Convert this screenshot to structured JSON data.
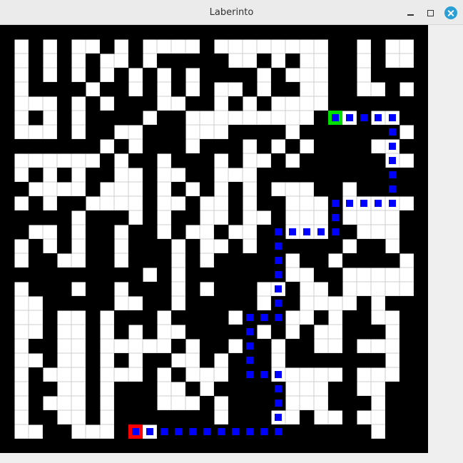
{
  "window": {
    "title": "Laberinto",
    "controls": [
      "minimize-icon",
      "maximize-icon",
      "close-icon"
    ]
  },
  "maze": {
    "columns": 30,
    "rows": 30,
    "cell_colors": {
      "wall": "#000000",
      "open": "#ffffff",
      "grid": "#cfcfcf"
    },
    "grid": [
      "000000000000000000000000000000",
      "010101101011110111111110010110",
      "010101011010000011010110010110",
      "010101010101010000101110010000",
      "010000100101010110100110011010",
      "011101010001100101011110000000",
      "010101000010011111111101101100",
      "011101001100011100001000000010",
      "000000010100010001010100001100",
      "011111101001000101101000000110",
      "010101001101100111000000000000",
      "001111011101010101011100100000",
      "010100111101101101001110111110",
      "000001000101001101101110111100",
      "001101001001011011001110011100",
      "010101001000101101000000100100",
      "010011001000101000001001000010",
      "000000000010100000001100111110",
      "010001001000101000110110111110",
      "011000001100100000100111101000",
      "011011010001000010001101001100",
      "011011010101100000101011000100",
      "010011011111010010010011011100",
      "011011010100110100010000000100",
      "010111011101011100011111011100",
      "010011010001101000001110011000",
      "010111010001110100001110001000",
      "010011010000000100011011011000",
      "011001110110000000000000001000",
      "000000000000000000000000000000"
    ],
    "path": [
      [
        23,
        6
      ],
      [
        24,
        6
      ],
      [
        25,
        6
      ],
      [
        26,
        6
      ],
      [
        27,
        6
      ],
      [
        27,
        7
      ],
      [
        27,
        8
      ],
      [
        27,
        9
      ],
      [
        27,
        10
      ],
      [
        27,
        11
      ],
      [
        27,
        12
      ],
      [
        26,
        12
      ],
      [
        25,
        12
      ],
      [
        24,
        12
      ],
      [
        23,
        12
      ],
      [
        23,
        13
      ],
      [
        23,
        14
      ],
      [
        22,
        14
      ],
      [
        21,
        14
      ],
      [
        20,
        14
      ],
      [
        19,
        14
      ],
      [
        19,
        15
      ],
      [
        19,
        16
      ],
      [
        19,
        17
      ],
      [
        19,
        18
      ],
      [
        19,
        19
      ],
      [
        19,
        20
      ],
      [
        18,
        20
      ],
      [
        17,
        20
      ],
      [
        17,
        21
      ],
      [
        17,
        22
      ],
      [
        17,
        23
      ],
      [
        17,
        24
      ],
      [
        18,
        24
      ],
      [
        19,
        24
      ],
      [
        19,
        25
      ],
      [
        19,
        26
      ],
      [
        19,
        27
      ],
      [
        19,
        28
      ],
      [
        18,
        28
      ],
      [
        17,
        28
      ],
      [
        16,
        28
      ],
      [
        15,
        28
      ],
      [
        14,
        28
      ],
      [
        13,
        28
      ],
      [
        12,
        28
      ],
      [
        11,
        28
      ],
      [
        10,
        28
      ],
      [
        9,
        28
      ]
    ],
    "start": [
      23,
      6
    ],
    "end": [
      9,
      28
    ],
    "path_color": "#0000ff",
    "start_color": "#00dd00",
    "end_color": "#ff0000"
  }
}
